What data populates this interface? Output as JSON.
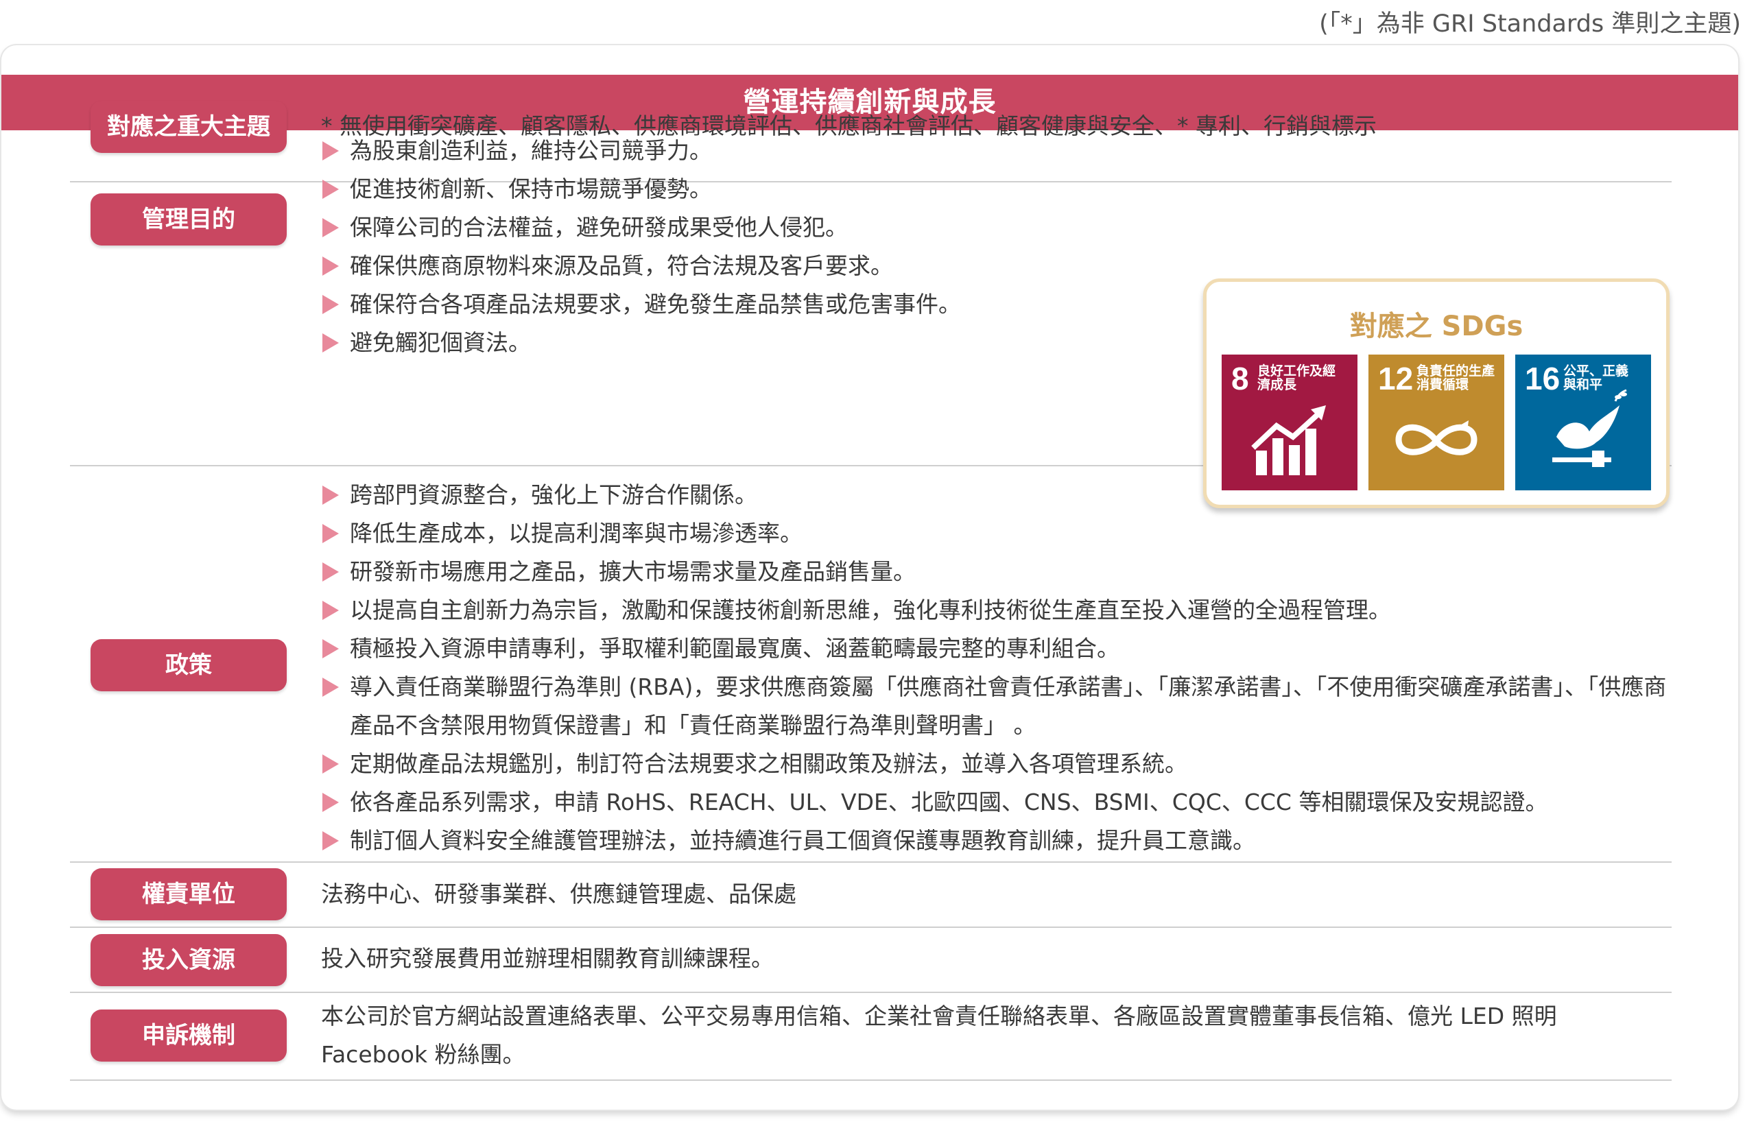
{
  "note": "(「*」為非 GRI Standards 準則之主題)",
  "title": "營運持續創新與成長",
  "rows": {
    "topics": {
      "label": "對應之重大主題",
      "text": "* 無使用衝突礦產、顧客隱私、供應商環境評估、供應商社會評估、顧客健康與安全、* 專利、行銷與標示"
    },
    "goals": {
      "label": "管理目的",
      "items": [
        "為股東創造利益，維持公司競爭力。",
        "促進技術創新、保持市場競爭優勢。",
        "保障公司的合法權益，避免研發成果受他人侵犯。",
        "確保供應商原物料來源及品質，符合法規及客戶要求。",
        "確保符合各項產品法規要求，避免發生產品禁售或危害事件。",
        "避免觸犯個資法。"
      ]
    },
    "policy": {
      "label": "政策",
      "items": [
        "跨部門資源整合，強化上下游合作關係。",
        "降低生產成本，以提高利潤率與市場滲透率。",
        "研發新市場應用之產品，擴大市場需求量及產品銷售量。",
        "以提高自主創新力為宗旨，激勵和保護技術創新思維，強化專利技術從生產直至投入運營的全過程管理。",
        "積極投入資源申請專利，爭取權利範圍最寬廣、涵蓋範疇最完整的專利組合。",
        "導入責任商業聯盟行為準則 (RBA)，要求供應商簽屬「供應商社會責任承諾書」、「廉潔承諾書」、「不使用衝突礦產承諾書」、「供應商產品不含禁限用物質保證書」和「責任商業聯盟行為準則聲明書」 。",
        "定期做產品法規鑑別，制訂符合法規要求之相關政策及辦法，並導入各項管理系統。",
        "依各產品系列需求，申請 RoHS、REACH、UL、VDE、北歐四國、CNS、BSMI、CQC、CCC 等相關環保及安規認證。",
        "制訂個人資料安全維護管理辦法，並持續進行員工個資保護專題教育訓練，提升員工意識。"
      ]
    },
    "unit": {
      "label": "權責單位",
      "text": "法務中心、研發事業群、供應鏈管理處、品保處"
    },
    "resources": {
      "label": "投入資源",
      "text": "投入研究發展費用並辦理相關教育訓練課程。"
    },
    "grievance": {
      "label": "申訴機制",
      "text": "本公司於官方網站設置連絡表單、公平交易專用信箱、企業社會責任聯絡表單、各廠區設置實體董事長信箱、億光 LED 照明 Facebook 粉絲團。"
    }
  },
  "sdgs": {
    "title": "對應之 SDGs",
    "tiles": [
      {
        "num": "8",
        "label": "良好工作及經濟成長",
        "color": "#a21942",
        "icon": "growth-chart-icon"
      },
      {
        "num": "12",
        "label": "負責任的生產消費循環",
        "color": "#bf8b2e",
        "icon": "infinity-loop-icon"
      },
      {
        "num": "16",
        "label": "公平、正義與和平",
        "color": "#00689d",
        "icon": "dove-gavel-icon"
      }
    ]
  },
  "colors": {
    "accent": "#c94761",
    "bullet": "#e8899b",
    "sdg_border": "#f1dcb3",
    "sdg_title": "#cfa056"
  }
}
